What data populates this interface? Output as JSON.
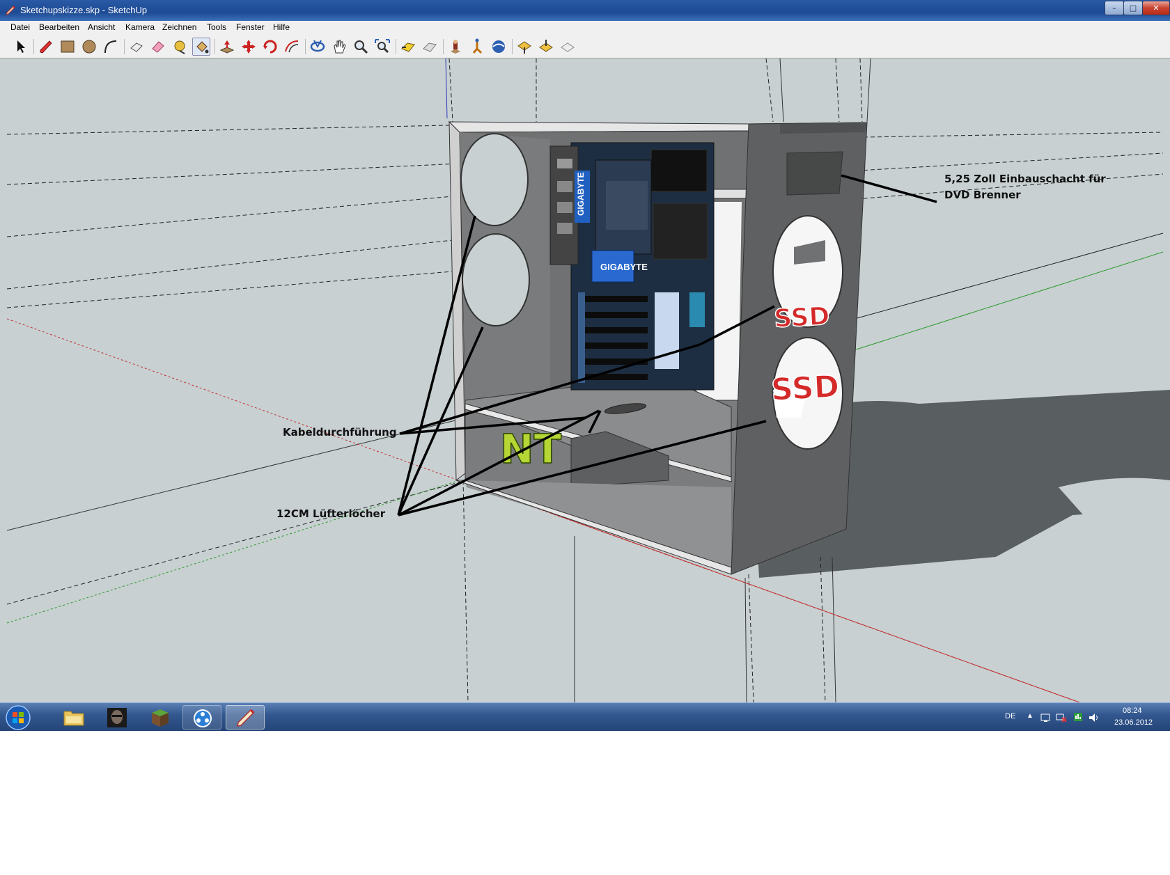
{
  "window": {
    "title": "Sketchupskizze.skp - SketchUp",
    "controls": {
      "minimize": "–",
      "maximize": "□",
      "close": "✕"
    }
  },
  "menu": {
    "items": [
      "Datei",
      "Bearbeiten",
      "Ansicht",
      "Kamera",
      "Zeichnen",
      "Tools",
      "Fenster",
      "Hilfe"
    ]
  },
  "toolbar": {
    "tools": [
      "select-icon",
      "pencil-icon",
      "rectangle-icon",
      "circle-icon",
      "arc-icon",
      "make-component-icon",
      "eraser-icon",
      "tape-measure-icon",
      "paint-bucket-icon",
      "push-pull-icon",
      "move-icon",
      "rotate-icon",
      "offset-icon",
      "orbit-icon",
      "pan-icon",
      "zoom-icon",
      "zoom-extents-icon",
      "previous-view-icon",
      "next-view-icon",
      "position-camera-icon",
      "walk-icon",
      "look-around-icon",
      "get-models-icon",
      "share-model-icon",
      "share-component-icon"
    ]
  },
  "scene": {
    "labels": {
      "drive_bay_line1": "5,25 Zoll Einbauschacht für",
      "drive_bay_line2": "DVD Brenner",
      "cable_routing": "Kabeldurchführung",
      "fan_holes": "12CM Lüfterlöcher"
    },
    "decals": {
      "board_brand": "GIGABYTE",
      "board_brand_short": "GIGABYTE",
      "psu": "NT",
      "ssd": "SSD",
      "ssd_upper": "SSD"
    }
  },
  "taskbar": {
    "language": "DE",
    "time": "08:24",
    "date": "23.06.2012",
    "apps": [
      "start-orb-icon",
      "explorer-folder-icon",
      "game-avatar-icon",
      "minecraft-block-icon",
      "media-player-icon",
      "sketchup-icon"
    ]
  }
}
